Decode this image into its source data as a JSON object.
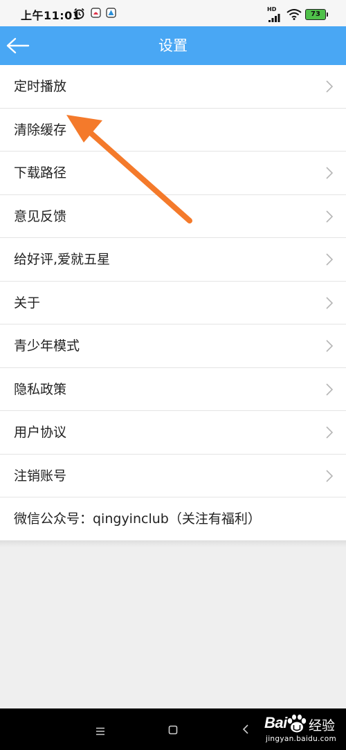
{
  "status_bar": {
    "time": "上午11:01",
    "network": "HD",
    "battery": "73"
  },
  "header": {
    "title": "设置",
    "back_icon": "arrow-left-icon",
    "background": "#49a7f4"
  },
  "settings": {
    "items": [
      {
        "label": "定时播放",
        "chevron": true
      },
      {
        "label": "清除缓存",
        "chevron": false
      },
      {
        "label": "下载路径",
        "chevron": true
      },
      {
        "label": "意见反馈",
        "chevron": true
      },
      {
        "label": "给好评,爱就五星",
        "chevron": true
      },
      {
        "label": "关于",
        "chevron": true
      },
      {
        "label": "青少年模式",
        "chevron": true
      },
      {
        "label": "隐私政策",
        "chevron": true
      },
      {
        "label": "用户协议",
        "chevron": true
      },
      {
        "label": "注销账号",
        "chevron": true
      },
      {
        "label": "微信公众号：qingyinclub（关注有福利）",
        "chevron": false
      }
    ]
  },
  "annotation": {
    "color": "#f47a2b",
    "icon": "annotation-arrow-icon"
  },
  "nav_bar": {
    "icons": [
      "menu-icon",
      "home-square-icon",
      "back-chevron-icon"
    ]
  },
  "watermark": {
    "brand": "Bai",
    "brand_cn": "经验",
    "domain": "jingyan.baidu.com"
  }
}
